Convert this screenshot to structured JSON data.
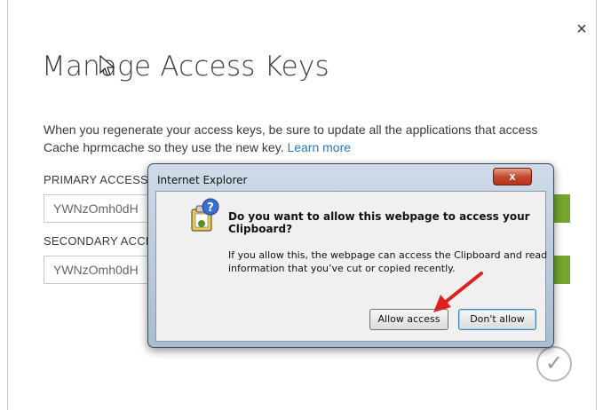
{
  "dialog": {
    "title": "Manage Access Keys",
    "close_glyph": "×",
    "description_text": "When you regenerate your access keys, be sure to update all the applications that access Cache hprmcache so they use the new key. ",
    "learn_more_label": "Learn more",
    "primary": {
      "label": "PRIMARY ACCESS",
      "value": "YWNzOmh0dH"
    },
    "secondary": {
      "label": "SECONDARY ACCE",
      "value": "YWNzOmh0dH"
    },
    "confirm_glyph": "✓"
  },
  "ie_prompt": {
    "window_title": "Internet Explorer",
    "close_glyph": "x",
    "heading": "Do you want to allow this webpage to access your Clipboard?",
    "body": "If you allow this, the webpage can access the Clipboard and read information that you’ve cut or copied recently.",
    "allow_label": "Allow access",
    "deny_label": "Don't allow",
    "icon": "security-warning-icon"
  },
  "colors": {
    "accent_green": "#74a52e",
    "link_blue": "#2a7abf",
    "annotation_red": "#e02020"
  }
}
